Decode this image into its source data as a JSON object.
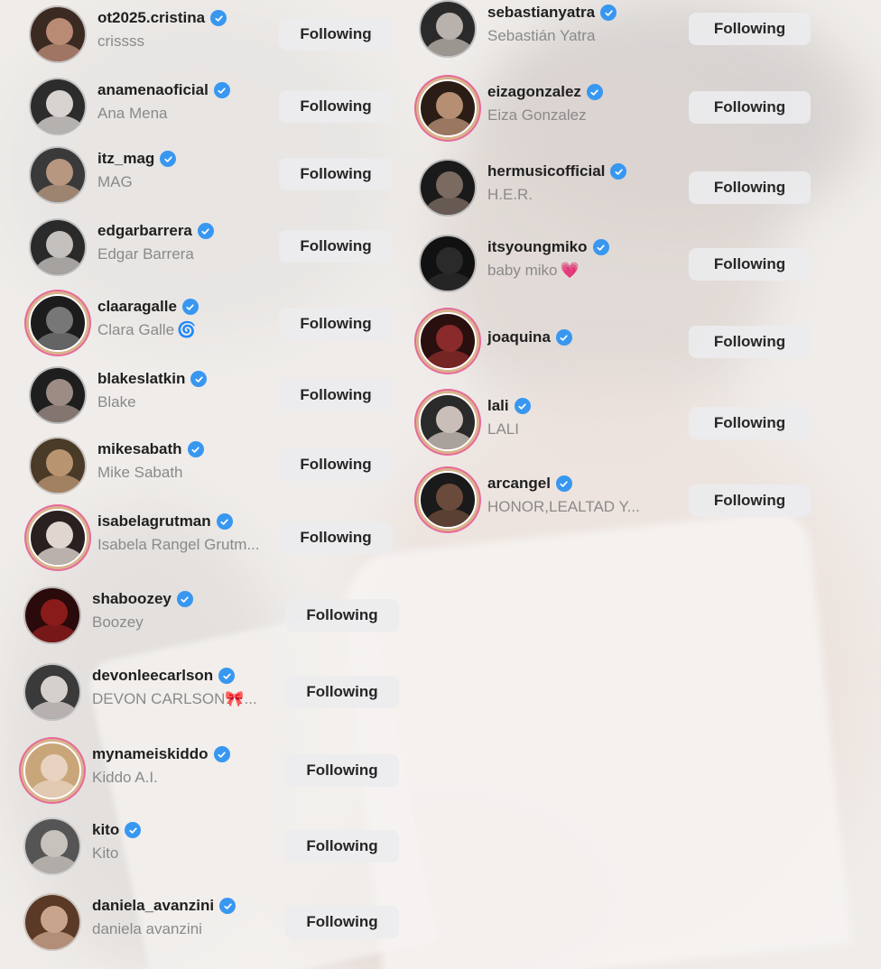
{
  "button_label": "Following",
  "left_column": [
    {
      "username": "ot2025.cristina",
      "name": "crissss",
      "story": false,
      "skin": "#b98a74",
      "hair": "#3b2a22"
    },
    {
      "username": "anamenaoficial",
      "name": "Ana Mena",
      "story": false,
      "skin": "#d8d3d0",
      "hair": "#2c2c2c"
    },
    {
      "username": "itz_mag",
      "name": "MAG",
      "story": false,
      "skin": "#b7977f",
      "hair": "#3a3a3a"
    },
    {
      "username": "edgarbarrera",
      "name": "Edgar Barrera",
      "story": false,
      "skin": "#c4c0bd",
      "hair": "#2a2a2a"
    },
    {
      "username": "claaragalle",
      "name": "Clara Galle",
      "suffix_glyph": "🌀",
      "story": true,
      "skin": "#777",
      "hair": "#1c1c1c"
    },
    {
      "username": "blakeslatkin",
      "name": "Blake",
      "story": false,
      "skin": "#9c8c84",
      "hair": "#1e1e1e"
    },
    {
      "username": "mikesabath",
      "name": "Mike Sabath",
      "story": false,
      "skin": "#b89470",
      "hair": "#4a3a28"
    },
    {
      "username": "isabelagrutman",
      "name": "Isabela Rangel Grutm...",
      "story": true,
      "skin": "#e0d6cf",
      "hair": "#2a2020"
    },
    {
      "username": "shaboozey",
      "name": "Boozey",
      "story": false,
      "skin": "#8a1b1b",
      "hair": "#2a0a0a"
    },
    {
      "username": "devonleecarlson",
      "name": "DEVON CARLSON🎀...",
      "story": false,
      "skin": "#d6d0cc",
      "hair": "#3a3a3a"
    },
    {
      "username": "mynameiskiddo",
      "name": "Kiddo A.I.",
      "story": true,
      "skin": "#e8d2c0",
      "hair": "#c9a57a"
    },
    {
      "username": "kito",
      "name": "Kito",
      "story": false,
      "skin": "#c8c2bc",
      "hair": "#555"
    },
    {
      "username": "daniela_avanzini",
      "name": "daniela avanzini",
      "story": false,
      "skin": "#c9a48c",
      "hair": "#5a3a26"
    }
  ],
  "right_column": [
    {
      "username": "sebastianyatra",
      "name": "Sebastián Yatra",
      "story": false,
      "skin": "#b9b1ab",
      "hair": "#2a2a2a"
    },
    {
      "username": "eizagonzalez",
      "name": "Eiza Gonzalez",
      "story": true,
      "skin": "#b58e73",
      "hair": "#2b1d16"
    },
    {
      "username": "hermusicofficial",
      "name": "H.E.R.",
      "story": false,
      "skin": "#7a6a60",
      "hair": "#1a1a1a"
    },
    {
      "username": "itsyoungmiko",
      "name": "baby miko",
      "suffix_glyph": "💗",
      "story": false,
      "skin": "#2a2a2a",
      "hair": "#111"
    },
    {
      "username": "joaquina",
      "name": "",
      "story": true,
      "skin": "#8a2a2a",
      "hair": "#2a0f0f"
    },
    {
      "username": "lali",
      "name": "LALI",
      "story": true,
      "skin": "#c9bfb8",
      "hair": "#2a2a2a"
    },
    {
      "username": "arcangel",
      "name": "HONOR,LEALTAD Y...",
      "story": true,
      "skin": "#6a4a3a",
      "hair": "#1a1a1a"
    }
  ]
}
